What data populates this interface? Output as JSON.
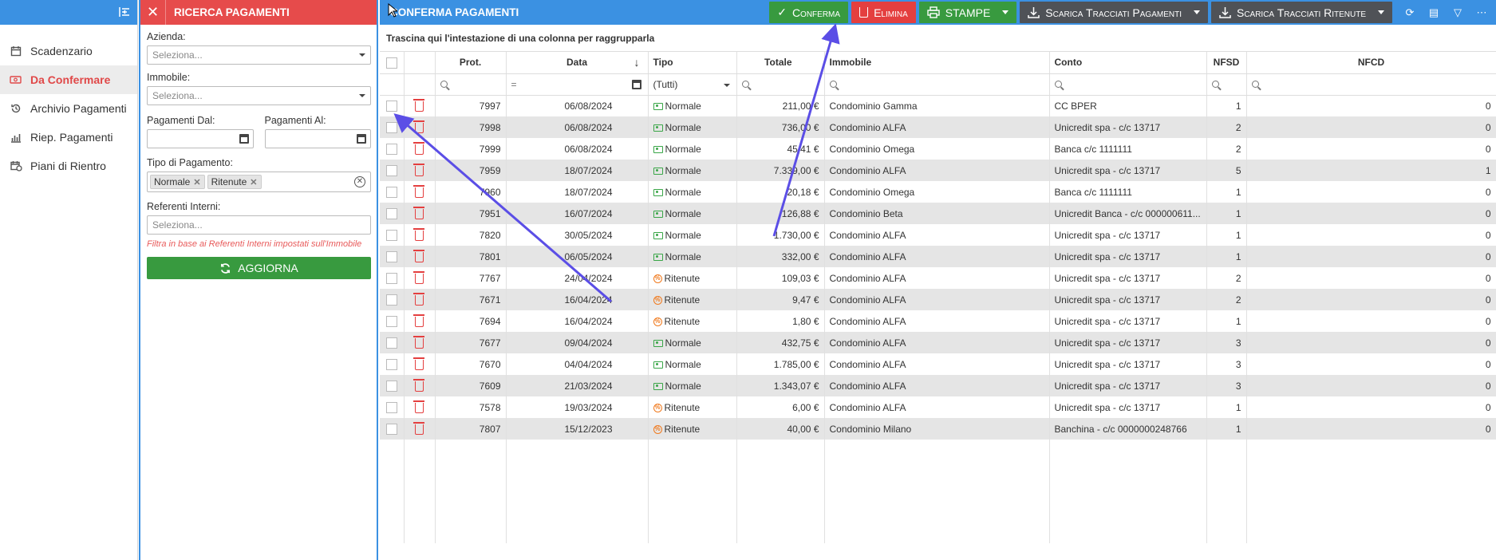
{
  "nav": {
    "items": [
      {
        "label": "Scadenzario",
        "icon": "calendar-icon"
      },
      {
        "label": "Da Confermare",
        "icon": "money-icon",
        "active": true
      },
      {
        "label": "Archivio Pagamenti",
        "icon": "history-icon"
      },
      {
        "label": "Riep. Pagamenti",
        "icon": "chart-icon"
      },
      {
        "label": "Piani di Rientro",
        "icon": "calendar-clock-icon"
      }
    ]
  },
  "filter": {
    "title": "RICERCA PAGAMENTI",
    "azienda_label": "Azienda:",
    "azienda_placeholder": "Seleziona...",
    "immobile_label": "Immobile:",
    "immobile_placeholder": "Seleziona...",
    "dal_label": "Pagamenti Dal:",
    "al_label": "Pagamenti Al:",
    "tipo_label": "Tipo di Pagamento:",
    "tipo_tags": [
      "Normale",
      "Ritenute"
    ],
    "referenti_label": "Referenti Interni:",
    "referenti_placeholder": "Seleziona...",
    "hint": "Filtra in base ai Referenti Interni impostati sull'Immobile",
    "refresh_label": "AGGIORNA"
  },
  "toolbar": {
    "title": "CONFERMA PAGAMENTI",
    "conferma": "Conferma",
    "elimina": "Elimina",
    "stampe": "STAMPE",
    "scarica_pagamenti": "Scarica Tracciati Pagamenti",
    "scarica_ritenute": "Scarica Tracciati Ritenute"
  },
  "grid": {
    "group_hint": "Trascina qui l'intestazione di una colonna per raggrupparla",
    "columns": {
      "prot": "Prot.",
      "data": "Data",
      "tipo": "Tipo",
      "totale": "Totale",
      "immobile": "Immobile",
      "conto": "Conto",
      "nfsd": "NFSD",
      "nfcd": "NFCD"
    },
    "tipo_filter": "(Tutti)",
    "rows": [
      {
        "prot": "7997",
        "data": "06/08/2024",
        "tipo": "Normale",
        "totale": "211,00 €",
        "immobile": "Condominio Gamma",
        "conto": "CC BPER",
        "nfsd": "1",
        "nfcd": "0"
      },
      {
        "prot": "7998",
        "data": "06/08/2024",
        "tipo": "Normale",
        "totale": "736,00 €",
        "immobile": "Condominio ALFA",
        "conto": "Unicredit spa - c/c 13717",
        "nfsd": "2",
        "nfcd": "0"
      },
      {
        "prot": "7999",
        "data": "06/08/2024",
        "tipo": "Normale",
        "totale": "45,41 €",
        "immobile": "Condominio Omega",
        "conto": "Banca c/c 1111111",
        "nfsd": "2",
        "nfcd": "0"
      },
      {
        "prot": "7959",
        "data": "18/07/2024",
        "tipo": "Normale",
        "totale": "7.339,00 €",
        "immobile": "Condominio ALFA",
        "conto": "Unicredit spa - c/c 13717",
        "nfsd": "5",
        "nfcd": "1"
      },
      {
        "prot": "7960",
        "data": "18/07/2024",
        "tipo": "Normale",
        "totale": "20,18 €",
        "immobile": "Condominio Omega",
        "conto": "Banca c/c 1111111",
        "nfsd": "1",
        "nfcd": "0"
      },
      {
        "prot": "7951",
        "data": "16/07/2024",
        "tipo": "Normale",
        "totale": "126,88 €",
        "immobile": "Condominio Beta",
        "conto": "Unicredit Banca - c/c 000000611...",
        "nfsd": "1",
        "nfcd": "0"
      },
      {
        "prot": "7820",
        "data": "30/05/2024",
        "tipo": "Normale",
        "totale": "1.730,00 €",
        "immobile": "Condominio ALFA",
        "conto": "Unicredit spa - c/c 13717",
        "nfsd": "1",
        "nfcd": "0"
      },
      {
        "prot": "7801",
        "data": "06/05/2024",
        "tipo": "Normale",
        "totale": "332,00 €",
        "immobile": "Condominio ALFA",
        "conto": "Unicredit spa - c/c 13717",
        "nfsd": "1",
        "nfcd": "0"
      },
      {
        "prot": "7767",
        "data": "24/04/2024",
        "tipo": "Ritenute",
        "totale": "109,03 €",
        "immobile": "Condominio ALFA",
        "conto": "Unicredit spa - c/c 13717",
        "nfsd": "2",
        "nfcd": "0"
      },
      {
        "prot": "7671",
        "data": "16/04/2024",
        "tipo": "Ritenute",
        "totale": "9,47 €",
        "immobile": "Condominio ALFA",
        "conto": "Unicredit spa - c/c 13717",
        "nfsd": "2",
        "nfcd": "0"
      },
      {
        "prot": "7694",
        "data": "16/04/2024",
        "tipo": "Ritenute",
        "totale": "1,80 €",
        "immobile": "Condominio ALFA",
        "conto": "Unicredit spa - c/c 13717",
        "nfsd": "1",
        "nfcd": "0"
      },
      {
        "prot": "7677",
        "data": "09/04/2024",
        "tipo": "Normale",
        "totale": "432,75 €",
        "immobile": "Condominio ALFA",
        "conto": "Unicredit spa - c/c 13717",
        "nfsd": "3",
        "nfcd": "0"
      },
      {
        "prot": "7670",
        "data": "04/04/2024",
        "tipo": "Normale",
        "totale": "1.785,00 €",
        "immobile": "Condominio ALFA",
        "conto": "Unicredit spa - c/c 13717",
        "nfsd": "3",
        "nfcd": "0"
      },
      {
        "prot": "7609",
        "data": "21/03/2024",
        "tipo": "Normale",
        "totale": "1.343,07 €",
        "immobile": "Condominio ALFA",
        "conto": "Unicredit spa - c/c 13717",
        "nfsd": "3",
        "nfcd": "0"
      },
      {
        "prot": "7578",
        "data": "19/03/2024",
        "tipo": "Ritenute",
        "totale": "6,00 €",
        "immobile": "Condominio ALFA",
        "conto": "Unicredit spa - c/c 13717",
        "nfsd": "1",
        "nfcd": "0"
      },
      {
        "prot": "7807",
        "data": "15/12/2023",
        "tipo": "Ritenute",
        "totale": "40,00 €",
        "immobile": "Condominio Milano",
        "conto": "Banchina - c/c 0000000248766",
        "nfsd": "1",
        "nfcd": "0"
      }
    ]
  },
  "colors": {
    "primary": "#3b91e2",
    "danger": "#e43f3f",
    "success": "#389a3f",
    "annotation": "#5b4ee6"
  }
}
